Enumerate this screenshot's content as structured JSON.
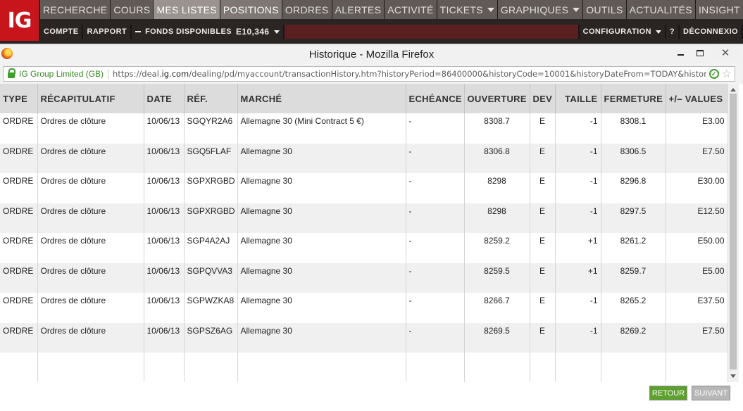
{
  "app": {
    "logo_text": "IG",
    "nav_main": [
      {
        "label": "RECHERCHE",
        "caret": false,
        "state": ""
      },
      {
        "label": "COURS",
        "caret": false,
        "state": ""
      },
      {
        "label": "MES LISTES",
        "caret": false,
        "state": "active"
      },
      {
        "label": "POSITIONS",
        "caret": false,
        "state": "active2"
      },
      {
        "label": "ORDRES",
        "caret": false,
        "state": ""
      },
      {
        "label": "ALERTES",
        "caret": false,
        "state": ""
      },
      {
        "label": "ACTIVITÉ",
        "caret": false,
        "state": ""
      },
      {
        "label": "TICKETS",
        "caret": true,
        "state": ""
      },
      {
        "label": "GRAPHIQUES",
        "caret": true,
        "state": ""
      },
      {
        "label": "OUTILS",
        "caret": false,
        "state": ""
      },
      {
        "label": "ACTUALITÉS",
        "caret": false,
        "state": ""
      },
      {
        "label": "INSIGHT",
        "caret": true,
        "state": ""
      }
    ],
    "sub_nav": {
      "compte": "COMPTE",
      "rapport": "RAPPORT",
      "funds_label": "FONDS DISPONIBLES",
      "funds_value": "E10,346",
      "configuration": "CONFIGURATION",
      "help": "?",
      "logout": "DÉCONNEXIO"
    }
  },
  "window": {
    "title": "Historique - Mozilla Firefox",
    "minimize": "–",
    "maximize": "□",
    "close": "✕",
    "identity": "IG Group Limited (GB)",
    "url_prefix": "https://deal.",
    "url_domain": "ig.com",
    "url_rest": "/dealing/pd/myaccount/transactionHistory.htm?historyPeriod=86400000&historyCode=10001&historyDateFrom=TODAY&historyDateTo=&",
    "star": "☆"
  },
  "table": {
    "headers": {
      "type": "TYPE",
      "recap": "RÉCAPITULATIF",
      "date": "DATE",
      "ref": "RÉF.",
      "marche": "MARCHÉ",
      "echeance": "ECHÉANCE",
      "ouverture": "OUVERTURE",
      "dev": "DEV",
      "taille": "TAILLE",
      "fermeture": "FERMETURE",
      "values": "+/– VALUES"
    },
    "rows": [
      {
        "type": "ORDRE",
        "recap": "Ordres de clôture",
        "date": "10/06/13",
        "ref": "SGQYR2A6",
        "marche": "Allemagne 30 (Mini Contract 5 €)",
        "echeance": "-",
        "ouverture": "8308.7",
        "dev": "E",
        "taille": "-1",
        "fermeture": "8308.1",
        "values": "E3.00"
      },
      {
        "type": "ORDRE",
        "recap": "Ordres de clôture",
        "date": "10/06/13",
        "ref": "SGQ5FLAF",
        "marche": "Allemagne 30",
        "echeance": "-",
        "ouverture": "8306.8",
        "dev": "E",
        "taille": "-1",
        "fermeture": "8306.5",
        "values": "E7.50"
      },
      {
        "type": "ORDRE",
        "recap": "Ordres de clôture",
        "date": "10/06/13",
        "ref": "SGPXRGBD",
        "marche": "Allemagne 30",
        "echeance": "-",
        "ouverture": "8298",
        "dev": "E",
        "taille": "-1",
        "fermeture": "8296.8",
        "values": "E30.00"
      },
      {
        "type": "ORDRE",
        "recap": "Ordres de clôture",
        "date": "10/06/13",
        "ref": "SGPXRGBD",
        "marche": "Allemagne 30",
        "echeance": "-",
        "ouverture": "8298",
        "dev": "E",
        "taille": "-1",
        "fermeture": "8297.5",
        "values": "E12.50"
      },
      {
        "type": "ORDRE",
        "recap": "Ordres de clôture",
        "date": "10/06/13",
        "ref": "SGP4A2AJ",
        "marche": "Allemagne 30",
        "echeance": "-",
        "ouverture": "8259.2",
        "dev": "E",
        "taille": "+1",
        "fermeture": "8261.2",
        "values": "E50.00"
      },
      {
        "type": "ORDRE",
        "recap": "Ordres de clôture",
        "date": "10/06/13",
        "ref": "SGPQVVA3",
        "marche": "Allemagne 30",
        "echeance": "-",
        "ouverture": "8259.5",
        "dev": "E",
        "taille": "+1",
        "fermeture": "8259.7",
        "values": "E5.00"
      },
      {
        "type": "ORDRE",
        "recap": "Ordres de clôture",
        "date": "10/06/13",
        "ref": "SGPWZKA8",
        "marche": "Allemagne 30",
        "echeance": "-",
        "ouverture": "8266.7",
        "dev": "E",
        "taille": "-1",
        "fermeture": "8265.2",
        "values": "E37.50"
      },
      {
        "type": "ORDRE",
        "recap": "Ordres de clôture",
        "date": "10/06/13",
        "ref": "SGPSZ6AG",
        "marche": "Allemagne 30",
        "echeance": "-",
        "ouverture": "8269.5",
        "dev": "E",
        "taille": "-1",
        "fermeture": "8269.2",
        "values": "E7.50"
      }
    ]
  },
  "footer": {
    "retour": "RETOUR",
    "suivant": "SUIVANT"
  }
}
